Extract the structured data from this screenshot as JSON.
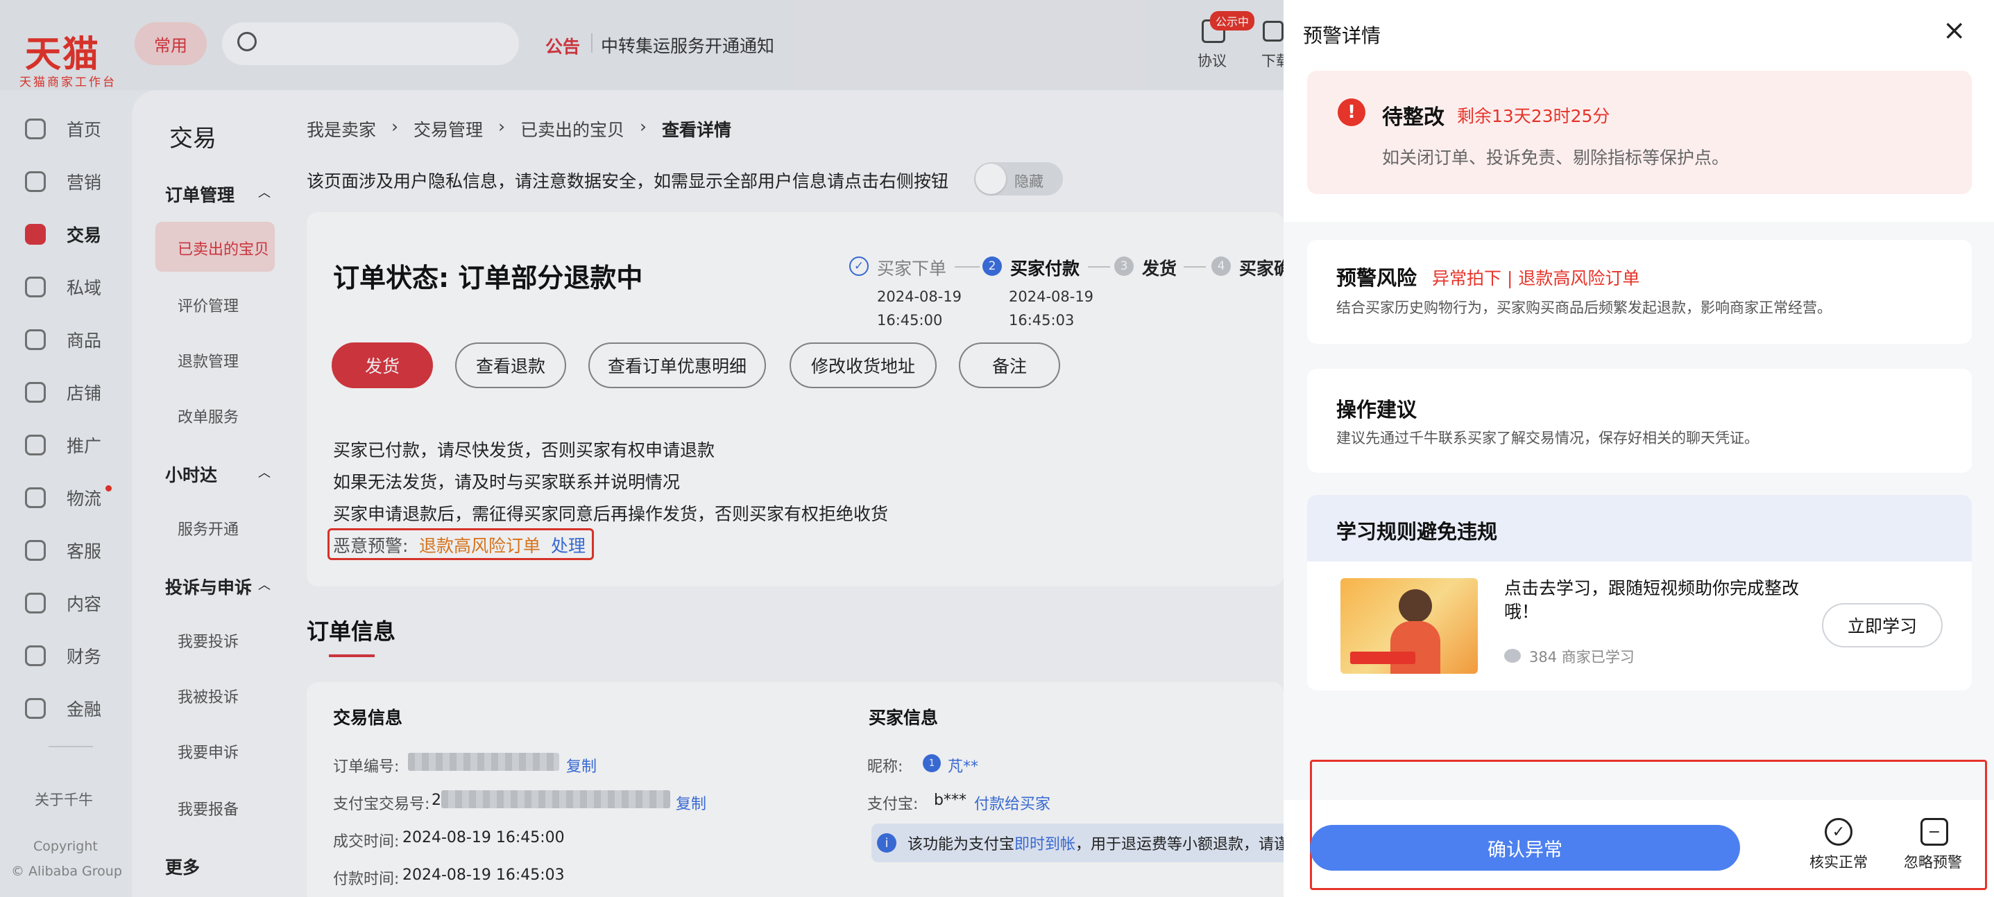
{
  "brand": {
    "name": "天猫",
    "subtitle": "天猫商家工作台"
  },
  "topbar": {
    "common_label": "常用",
    "search_placeholder": "",
    "notice_label": "公告",
    "notice_text": "中转集运服务开通通知",
    "protocol_label": "协议",
    "protocol_badge": "公示中",
    "download_label": "下载"
  },
  "nav": {
    "items": [
      {
        "label": "首页"
      },
      {
        "label": "营销"
      },
      {
        "label": "交易"
      },
      {
        "label": "私域"
      },
      {
        "label": "商品"
      },
      {
        "label": "店铺"
      },
      {
        "label": "推广"
      },
      {
        "label": "物流"
      },
      {
        "label": "客服"
      },
      {
        "label": "内容"
      },
      {
        "label": "财务"
      },
      {
        "label": "金融"
      }
    ],
    "about": "关于千牛",
    "copyright_1": "Copyright",
    "copyright_2": "© Alibaba Group"
  },
  "subnav": {
    "title": "交易",
    "groups": [
      {
        "label": "订单管理",
        "items": [
          "已卖出的宝贝",
          "评价管理",
          "退款管理",
          "改单服务"
        ]
      },
      {
        "label": "小时达",
        "items": [
          "服务开通"
        ]
      },
      {
        "label": "投诉与申诉",
        "items": [
          "我要投诉",
          "我被投诉",
          "我要申诉",
          "我要报备"
        ]
      }
    ],
    "more": "更多"
  },
  "breadcrumb": [
    "我是卖家",
    "交易管理",
    "已卖出的宝贝",
    "查看详情"
  ],
  "privacy": {
    "text": "该页面涉及用户隐私信息，请注意数据安全，如需显示全部用户信息请点击右侧按钮",
    "toggle_label": "隐藏"
  },
  "order_status": {
    "title": "订单状态: 订单部分退款中",
    "steps": [
      {
        "num": "✓",
        "label": "买家下单",
        "date": "2024-08-19",
        "time": "16:45:00"
      },
      {
        "num": "2",
        "label": "买家付款",
        "date": "2024-08-19",
        "time": "16:45:03"
      },
      {
        "num": "3",
        "label": "发货"
      },
      {
        "num": "4",
        "label": "买家确"
      }
    ],
    "buttons": [
      "发货",
      "查看退款",
      "查看订单优惠明细",
      "修改收货地址",
      "备注"
    ],
    "tips": [
      "买家已付款，请尽快发货，否则买家有权申请退款",
      "如果无法发货，请及时与买家联系并说明情况",
      "买家申请退款后，需征得买家同意后再操作发货，否则买家有权拒绝收货"
    ],
    "risk_label": "恶意预警:",
    "risk_link": "退款高风险订单",
    "risk_action": "处理"
  },
  "order_info": {
    "title": "订单信息",
    "trade": {
      "heading": "交易信息",
      "order_no_label": "订单编号:",
      "copy_1": "复制",
      "alipay_no_label": "支付宝交易号:",
      "alipay_no_prefix": "2",
      "copy_2": "复制",
      "deal_time_label": "成交时间:",
      "deal_time": "2024-08-19 16:45:00",
      "pay_time_label": "付款时间:",
      "pay_time": "2024-08-19 16:45:03"
    },
    "buyer": {
      "heading": "买家信息",
      "nick_label": "昵称:",
      "nick": "芃**",
      "alipay_label": "支付宝:",
      "alipay": "b***",
      "pay_buyer_link": "付款给买家",
      "note_prefix": "该功能为支付宝",
      "note_link": "即时到帐",
      "note_suffix": "，用于退运费等小额退款，请谨"
    }
  },
  "drawer": {
    "title": "预警详情",
    "warn": {
      "title": "待整改",
      "countdown": "剩余13天23时25分",
      "desc": "如关闭订单、投诉免责、剔除指标等保护点。"
    },
    "risk": {
      "title": "预警风险",
      "tag": "异常拍下 | 退款高风险订单",
      "desc": "结合买家历史购物行为，买家购买商品后频繁发起退款，影响商家正常经营。"
    },
    "suggest": {
      "title": "操作建议",
      "desc": "建议先通过千牛联系买家了解交易情况，保存好相关的聊天凭证。"
    },
    "learn": {
      "title": "学习规则避免违规",
      "text": "点击去学习，跟随短视频助你完成整改哦！",
      "count": "384 商家已学习",
      "button": "立即学习"
    },
    "footer": {
      "confirm": "确认异常",
      "verify_normal": "核实正常",
      "ignore": "忽略预警"
    }
  },
  "colors": {
    "brand_red": "#e5342a",
    "primary_blue": "#4c80f0",
    "warn_bg": "#fdeeee"
  }
}
